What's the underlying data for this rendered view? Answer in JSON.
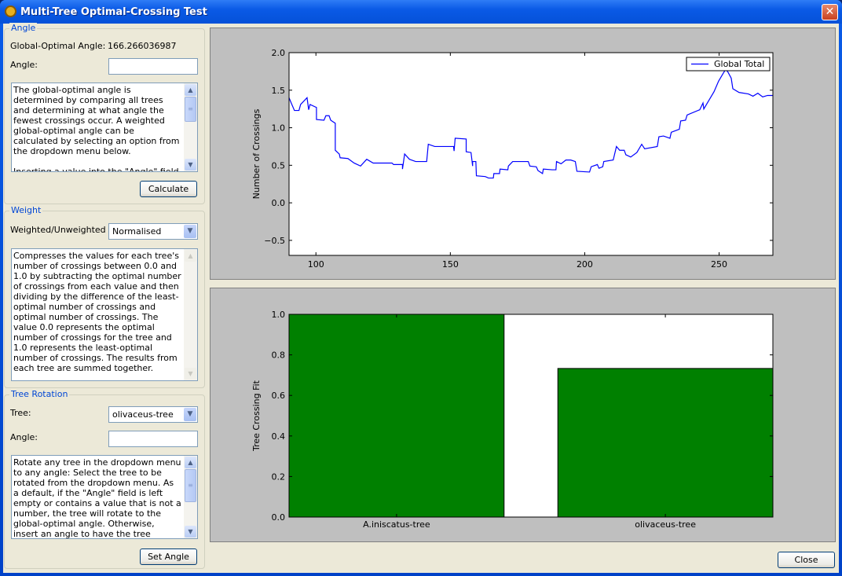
{
  "window": {
    "title": "Multi-Tree Optimal-Crossing Test",
    "close_glyph": "✕"
  },
  "angle_group": {
    "label": "Angle",
    "global_label": "Global-Optimal Angle:",
    "global_value": "166.266036987",
    "angle_label": "Angle:",
    "angle_value": "",
    "description": "The global-optimal angle is determined by comparing all trees and determining at what angle the fewest crossings occur. A weighted global-optimal angle can be calculated by selecting an option from the dropdown menu below.\n\nInserting a value into the \"Angle\" field will",
    "calculate_label": "Calculate"
  },
  "weight_group": {
    "label": "Weight",
    "weight_label": "Weighted/Unweighted :",
    "weight_value": "Normalised",
    "description": "Compresses the values for each tree's number of crossings between 0.0 and 1.0 by subtracting the optimal number of crossings from each value and then dividing by the difference of the least-optimal number of crossings and optimal number of crossings. The value 0.0 represents the optimal number of crossings for the tree and 1.0 represents the least-optimal number of crossings. The results from each tree are summed together."
  },
  "rotation_group": {
    "label": "Tree Rotation",
    "tree_label": "Tree:",
    "tree_value": "olivaceus-tree",
    "angle_label": "Angle:",
    "angle_value": "",
    "description": "Rotate any tree in the dropdown menu to any angle: Select the tree to be rotated from the dropdown menu. As a default, if the \"Angle\" field is left empty or contains a value that is not a number, the tree will rotate to the global-optimal angle. Otherwise, insert an angle to have the tree",
    "set_angle_label": "Set Angle"
  },
  "footer": {
    "close_label": "Close"
  },
  "chart_data": [
    {
      "type": "line",
      "title": "",
      "xlabel": "",
      "ylabel": "Number of Crossings",
      "xlim": [
        90,
        270
      ],
      "ylim": [
        -0.7,
        2.0
      ],
      "xticks": [
        100,
        150,
        200,
        250
      ],
      "yticks": [
        -0.5,
        0.0,
        0.5,
        1.0,
        1.5,
        2.0
      ],
      "ytick_labels": [
        "−0.5",
        "0.0",
        "0.5",
        "1.0",
        "1.5",
        "2.0"
      ],
      "grid": false,
      "legend": "top-right",
      "color": "#0000ff",
      "series": [
        {
          "name": "Global Total",
          "x": [
            90,
            90.8,
            92,
            93.7,
            94.3,
            96.7,
            97.3,
            97.8,
            100.2,
            100.2,
            103,
            103.7,
            104.9,
            105.5,
            107.2,
            107.2,
            108.7,
            109,
            111.9,
            114.2,
            116.6,
            118.9,
            121.3,
            128.3,
            128.9,
            132.2,
            132.2,
            133,
            134.8,
            137.1,
            141.2,
            141.8,
            144.2,
            151.2,
            151.4,
            151.8,
            155.9,
            155.9,
            157.7,
            158.3,
            158.3,
            159.5,
            159.7,
            163,
            164.2,
            166,
            166.2,
            168.3,
            168.5,
            171.4,
            171.6,
            173.2,
            179,
            179.6,
            182,
            182.6,
            184.3,
            184.6,
            187.9,
            189.3,
            189.5,
            191.2,
            193,
            194.8,
            196.5,
            197.1,
            201.8,
            202.4,
            204.7,
            205.3,
            206.7,
            207.1,
            210.6,
            211.8,
            213,
            214.7,
            215.3,
            217.1,
            219.4,
            221.2,
            222.3,
            227,
            227.6,
            229.3,
            231.7,
            232.2,
            235.2,
            235.7,
            237.5,
            238.1,
            242.8,
            244,
            244.3,
            248.1,
            249.8,
            251.6,
            252.5,
            253.3,
            254.5,
            255.1,
            257.4,
            260.9,
            262.6,
            264.4,
            266.2,
            268,
            270
          ],
          "y": [
            1.4,
            1.33,
            1.23,
            1.23,
            1.31,
            1.4,
            1.24,
            1.31,
            1.27,
            1.11,
            1.1,
            1.16,
            1.16,
            1.1,
            1.06,
            0.7,
            0.65,
            0.6,
            0.59,
            0.53,
            0.49,
            0.58,
            0.53,
            0.53,
            0.51,
            0.51,
            0.45,
            0.65,
            0.58,
            0.55,
            0.55,
            0.78,
            0.75,
            0.75,
            0.69,
            0.86,
            0.85,
            0.68,
            0.67,
            0.49,
            0.55,
            0.55,
            0.36,
            0.35,
            0.33,
            0.33,
            0.39,
            0.39,
            0.45,
            0.44,
            0.49,
            0.55,
            0.55,
            0.49,
            0.48,
            0.43,
            0.39,
            0.45,
            0.44,
            0.44,
            0.55,
            0.52,
            0.57,
            0.57,
            0.55,
            0.42,
            0.41,
            0.48,
            0.51,
            0.46,
            0.48,
            0.55,
            0.57,
            0.75,
            0.7,
            0.7,
            0.64,
            0.61,
            0.67,
            0.78,
            0.72,
            0.75,
            0.88,
            0.89,
            0.86,
            0.94,
            0.98,
            1.09,
            1.1,
            1.17,
            1.24,
            1.33,
            1.25,
            1.48,
            1.62,
            1.73,
            1.78,
            1.74,
            1.66,
            1.52,
            1.47,
            1.45,
            1.42,
            1.46,
            1.41,
            1.43,
            1.43
          ]
        }
      ]
    },
    {
      "type": "bar",
      "title": "",
      "xlabel": "",
      "ylabel": "Tree Crossing Fit",
      "xlim": [
        -0.4,
        1.4
      ],
      "ylim": [
        0,
        1.0
      ],
      "yticks": [
        0.0,
        0.2,
        0.4,
        0.6,
        0.8,
        1.0
      ],
      "ytick_labels": [
        "0.0",
        "0.2",
        "0.4",
        "0.6",
        "0.8",
        "1.0"
      ],
      "grid": false,
      "color": "#008000",
      "categories": [
        "A.iniscatus-tree",
        "olivaceus-tree"
      ],
      "values": [
        1.0,
        0.733
      ]
    }
  ]
}
